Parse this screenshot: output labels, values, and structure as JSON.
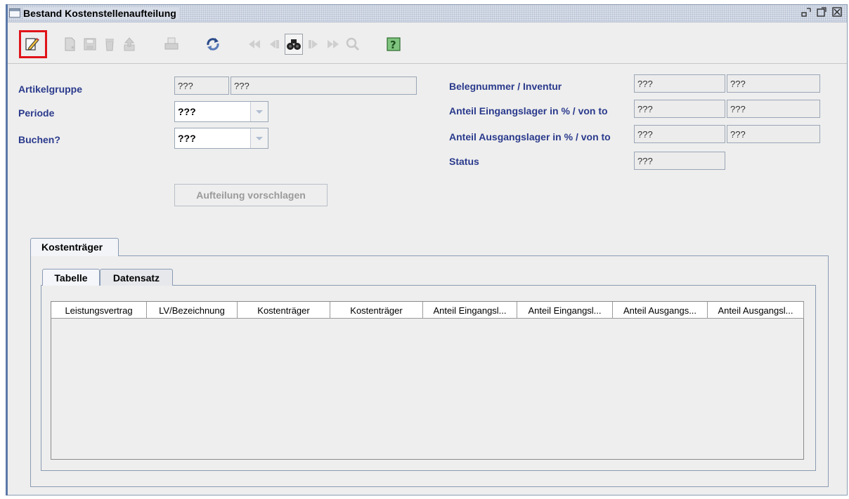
{
  "window": {
    "title": "Bestand Kostenstellenaufteilung",
    "controls": [
      "minimize-icon",
      "maximize-icon",
      "close-icon"
    ]
  },
  "toolbar": {
    "buttons": [
      {
        "icon": "edit-icon",
        "enabled": true,
        "highlighted": true
      },
      {
        "icon": "new-record-icon",
        "enabled": false
      },
      {
        "icon": "save-icon",
        "enabled": false
      },
      {
        "icon": "delete-icon",
        "enabled": false
      },
      {
        "icon": "export-icon",
        "enabled": false
      },
      {
        "icon": "print-icon",
        "enabled": false
      },
      {
        "icon": "refresh-icon",
        "enabled": true
      },
      {
        "icon": "first-record-icon",
        "enabled": false
      },
      {
        "icon": "previous-record-icon",
        "enabled": false
      },
      {
        "icon": "binoculars-search-icon",
        "enabled": true
      },
      {
        "icon": "next-record-icon",
        "enabled": false
      },
      {
        "icon": "last-record-icon",
        "enabled": false
      },
      {
        "icon": "magnifier-icon",
        "enabled": false
      },
      {
        "icon": "help-icon",
        "enabled": true
      }
    ],
    "highlight_color": "#e0141a"
  },
  "form": {
    "artikelgruppe": {
      "label": "Artikelgruppe",
      "code": "???",
      "name": "???"
    },
    "periode": {
      "label": "Periode",
      "value": "???"
    },
    "buchen": {
      "label": "Buchen?",
      "value": "???"
    },
    "belegnummer": {
      "label": "Belegnummer / Inventur",
      "value1": "???",
      "value2": "???"
    },
    "anteil_eingang": {
      "label": "Anteil Eingangslager in % / von to",
      "value1": "???",
      "value2": "???"
    },
    "anteil_ausgang": {
      "label": "Anteil Ausgangslager in % / von to",
      "value1": "???",
      "value2": "???"
    },
    "status": {
      "label": "Status",
      "value": "???"
    },
    "suggest_button": "Aufteilung vorschlagen"
  },
  "tabs": {
    "outer": {
      "label": "Kostenträger"
    },
    "inner": [
      {
        "label": "Tabelle",
        "active": true
      },
      {
        "label": "Datensatz",
        "active": false
      }
    ]
  },
  "table": {
    "columns": [
      "Leistungsvertrag",
      "LV/Bezeichnung",
      "Kostenträger",
      "Kostenträger",
      "Anteil Eingangsl...",
      "Anteil Eingangsl...",
      "Anteil Ausgangs...",
      "Anteil Ausgangsl..."
    ],
    "rows": []
  },
  "colors": {
    "label_text": "#2a3a8c",
    "window_bg": "#eeeeee",
    "border": "#8a9bb3"
  }
}
